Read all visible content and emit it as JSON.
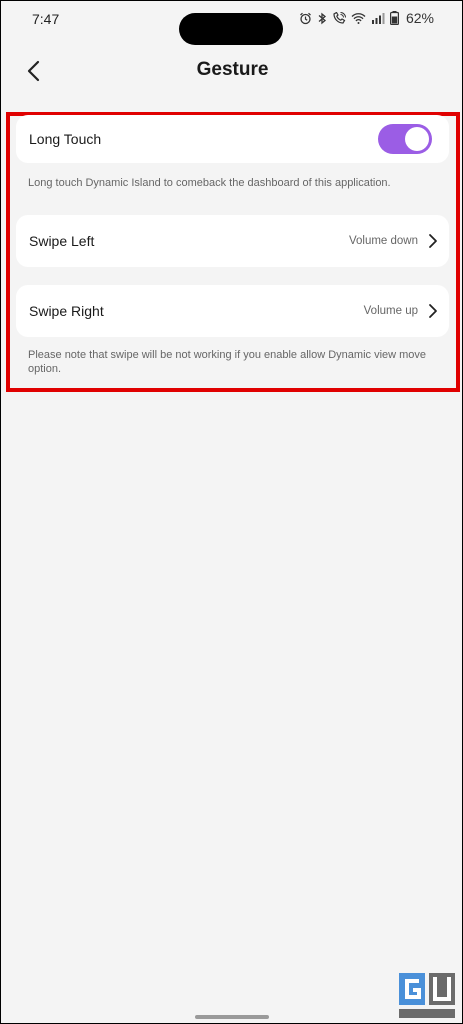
{
  "status_bar": {
    "time": "7:47",
    "battery": "62%",
    "icons": [
      "alarm-icon",
      "bluetooth-icon",
      "wifi-calling-icon",
      "wifi-icon",
      "signal-icon",
      "battery-icon"
    ]
  },
  "header": {
    "title": "Gesture",
    "back_icon": "chevron-left-icon"
  },
  "settings": {
    "long_touch": {
      "label": "Long Touch",
      "enabled": true,
      "description": "Long touch Dynamic Island to comeback the dashboard of this application."
    },
    "swipe_left": {
      "label": "Swipe Left",
      "value": "Volume down"
    },
    "swipe_right": {
      "label": "Swipe Right",
      "value": "Volume up"
    },
    "swipe_note": "Please note that swipe will be not working if you enable allow Dynamic view move option."
  },
  "colors": {
    "toggle_on": "#9b5de5",
    "highlight": "#e00000",
    "background": "#f4f4f4"
  },
  "watermark": {
    "text": "GADGETS TO USE"
  }
}
